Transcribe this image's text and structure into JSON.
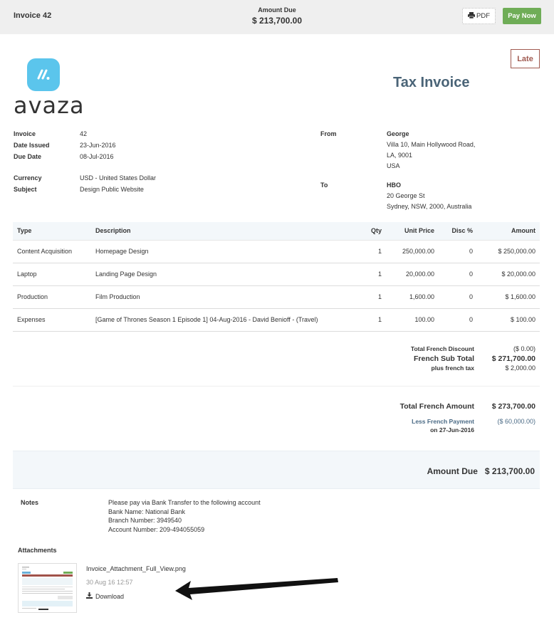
{
  "topbar": {
    "title": "Invoice 42",
    "amount_due_label": "Amount Due",
    "amount_due_value": "$ 213,700.00",
    "pdf_label": "PDF",
    "pay_now_label": "Pay Now"
  },
  "brand": {
    "logo_text": "avaza",
    "logo_color": "#5bc5ec"
  },
  "status_badge": "Late",
  "doc_title": "Tax Invoice",
  "meta": [
    {
      "label": "Invoice",
      "value": "42"
    },
    {
      "label": "Date Issued",
      "value": "23-Jun-2016"
    },
    {
      "label": "Due Date",
      "value": "08-Jul-2016"
    }
  ],
  "meta2": [
    {
      "label": "Currency",
      "value": "USD - United States Dollar"
    },
    {
      "label": "Subject",
      "value": "Design Public Website"
    }
  ],
  "from": {
    "label": "From",
    "name": "George",
    "lines": [
      "Villa 10, Main Hollywood Road,",
      "LA, 9001",
      "USA"
    ]
  },
  "to": {
    "label": "To",
    "name": "HBO",
    "lines": [
      "20 George St",
      "Sydney, NSW, 2000, Australia"
    ]
  },
  "table": {
    "headers": [
      "Type",
      "Description",
      "Qty",
      "Unit Price",
      "Disc %",
      "Amount"
    ],
    "rows": [
      [
        "Content Acquisition",
        "Homepage Design",
        "1",
        "250,000.00",
        "0",
        "$ 250,000.00"
      ],
      [
        "Laptop",
        "Landing Page Design",
        "1",
        "20,000.00",
        "0",
        "$ 20,000.00"
      ],
      [
        "Production",
        "Film Production",
        "1",
        "1,600.00",
        "0",
        "$ 1,600.00"
      ],
      [
        "Expenses",
        "[Game of Thrones Season 1 Episode 1] 04-Aug-2016 - David Benioff - (Travel)",
        "1",
        "100.00",
        "0",
        "$ 100.00"
      ]
    ]
  },
  "totals": {
    "discount_label": "Total French Discount",
    "discount_value": "($ 0.00)",
    "subtotal_label": "French Sub Total",
    "subtotal_value": "$ 271,700.00",
    "tax_label": "plus french tax",
    "tax_value": "$ 2,000.00",
    "total_label": "Total French Amount",
    "total_value": "$ 273,700.00",
    "payment_label": "Less French Payment",
    "payment_date": "on 27-Jun-2016",
    "payment_value": "($ 60,000.00)",
    "amount_due_label": "Amount Due",
    "amount_due_value": "$ 213,700.00"
  },
  "notes": {
    "label": "Notes",
    "lines": [
      "Please pay via Bank Transfer to the following account",
      "Bank Name: National Bank",
      "Branch Number: 3949540",
      "Account Number: 209-494055059"
    ]
  },
  "attachments": {
    "label": "Attachments",
    "items": [
      {
        "filename": "Invoice_Attachment_Full_View.png",
        "date": "30 Aug 16 12:57",
        "download_label": "Download"
      }
    ]
  },
  "colors": {
    "pay_button": "#6fad57",
    "late_badge": "#a05a50",
    "title": "#4a6477",
    "payment_link": "#4a6a85"
  }
}
